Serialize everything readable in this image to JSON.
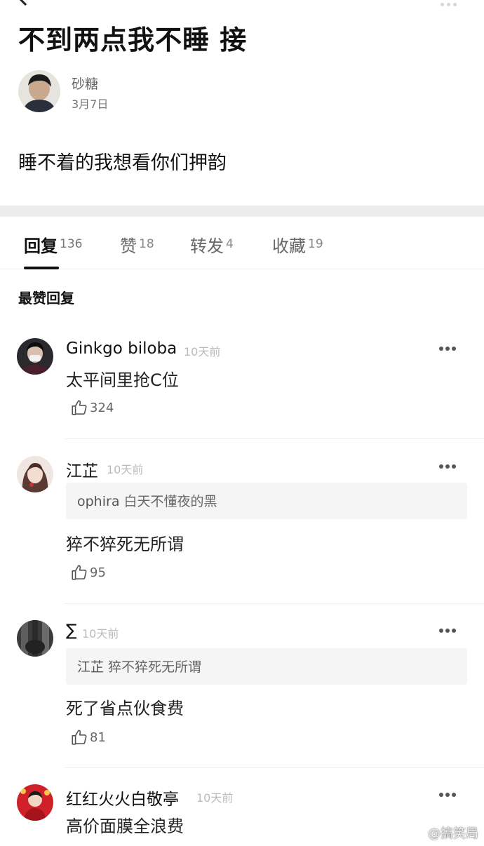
{
  "post": {
    "title": "不到两点我不睡 接",
    "author": "砂糖",
    "date": "3月7日",
    "body": "睡不着的我想看你们押韵"
  },
  "tabs": [
    {
      "label": "回复",
      "count": "136",
      "active": true
    },
    {
      "label": "赞",
      "count": "18",
      "active": false
    },
    {
      "label": "转发",
      "count": "4",
      "active": false
    },
    {
      "label": "收藏",
      "count": "19",
      "active": false
    }
  ],
  "section_heading": "最赞回复",
  "comments": [
    {
      "name": "Ginkgo biloba",
      "time": "10天前",
      "quote_user": "",
      "quote_text": "",
      "text": "太平间里抢C位",
      "likes": "324"
    },
    {
      "name": "江芷",
      "time": "10天前",
      "quote_user": "ophira",
      "quote_text": "白天不懂夜的黑",
      "text": "猝不猝死无所谓",
      "likes": "95"
    },
    {
      "name": "∑",
      "time": "10天前",
      "quote_user": "江芷",
      "quote_text": "猝不猝死无所谓",
      "text": "死了省点伙食费",
      "likes": "81"
    },
    {
      "name": "红红火火白敬亭",
      "time": "10天前",
      "quote_user": "",
      "quote_text": "",
      "text": "高价面膜全浪费",
      "likes": ""
    }
  ],
  "watermark": "@搞笑局",
  "icons": {
    "back": "chevron-left-icon",
    "more": "more-dots-icon",
    "like": "thumbs-up-icon"
  },
  "colors": {
    "text_primary": "#111111",
    "text_secondary": "#666666",
    "timestamp": "#bbbbbb",
    "quote_bg": "#f5f5f5",
    "divider": "#ececec",
    "avatar_festive_red": "#d0202a"
  }
}
